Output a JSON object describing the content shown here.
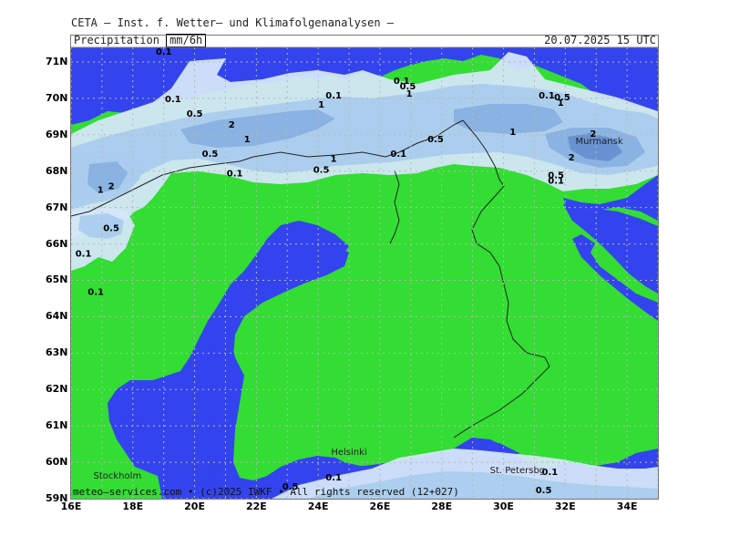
{
  "header": {
    "title": "CETA – Inst. f. Wetter– und Klimafolgenanalysen –",
    "subtitle_prefix": "Precipitation",
    "unit": "mm/6h",
    "datetime": "20.07.2025  15 UTC"
  },
  "footer": "meteo–services.com • (c)2025 IWKF • All rights reserved (12+027)",
  "axes": {
    "lat_labels": [
      "71N",
      "70N",
      "69N",
      "68N",
      "67N",
      "66N",
      "65N",
      "64N",
      "63N",
      "62N",
      "61N",
      "60N",
      "59N"
    ],
    "lon_labels": [
      "16E",
      "18E",
      "20E",
      "22E",
      "24E",
      "26E",
      "28E",
      "30E",
      "32E",
      "34E"
    ],
    "lat_range": [
      59,
      71.4
    ],
    "lon_range": [
      16,
      35
    ]
  },
  "colors": {
    "land": "#33dd33",
    "sea": "#3344ee",
    "precip_0_1": "#d4e6f8",
    "precip_0_5": "#aaccee",
    "precip_1": "#88b0e0",
    "precip_2": "#6690d0",
    "grid": "#b8b8b8",
    "border": "#222222"
  },
  "cities": [
    {
      "name": "Helsinki",
      "lon": 25.0,
      "lat": 60.2
    },
    {
      "name": "Stockholm",
      "lon": 17.5,
      "lat": 59.55
    },
    {
      "name": "St. Petersbg.",
      "lon": 30.5,
      "lat": 59.7
    },
    {
      "name": "Murmansk",
      "lon": 33.1,
      "lat": 68.75
    }
  ],
  "contour_labels": [
    {
      "text": "0.1",
      "lon": 19.0,
      "lat": 71.2
    },
    {
      "text": "0.1",
      "lon": 19.3,
      "lat": 69.9
    },
    {
      "text": "0.5",
      "lon": 20.0,
      "lat": 69.5
    },
    {
      "text": "2",
      "lon": 21.2,
      "lat": 69.2
    },
    {
      "text": "1",
      "lon": 21.7,
      "lat": 68.8
    },
    {
      "text": "0.5",
      "lon": 20.5,
      "lat": 68.4
    },
    {
      "text": "0.1",
      "lon": 21.3,
      "lat": 67.85
    },
    {
      "text": "0.1",
      "lon": 24.5,
      "lat": 70.0
    },
    {
      "text": "1",
      "lon": 24.1,
      "lat": 69.75
    },
    {
      "text": "1",
      "lon": 24.5,
      "lat": 68.25
    },
    {
      "text": "0.5",
      "lon": 24.1,
      "lat": 67.95
    },
    {
      "text": "0.1",
      "lon": 26.6,
      "lat": 68.4
    },
    {
      "text": "0.1",
      "lon": 26.7,
      "lat": 70.4
    },
    {
      "text": "0.5",
      "lon": 26.9,
      "lat": 70.25
    },
    {
      "text": "1",
      "lon": 26.95,
      "lat": 70.05
    },
    {
      "text": "0.5",
      "lon": 27.8,
      "lat": 68.8
    },
    {
      "text": "1",
      "lon": 30.3,
      "lat": 69.0
    },
    {
      "text": "0.1",
      "lon": 31.4,
      "lat": 70.0
    },
    {
      "text": "0.5",
      "lon": 31.9,
      "lat": 69.95
    },
    {
      "text": "1",
      "lon": 31.85,
      "lat": 69.8
    },
    {
      "text": "2",
      "lon": 32.9,
      "lat": 68.95
    },
    {
      "text": "2",
      "lon": 32.2,
      "lat": 68.3
    },
    {
      "text": "0.5",
      "lon": 31.7,
      "lat": 67.8
    },
    {
      "text": "0.1",
      "lon": 31.7,
      "lat": 67.65
    },
    {
      "text": "2",
      "lon": 17.3,
      "lat": 67.5
    },
    {
      "text": "1",
      "lon": 16.95,
      "lat": 67.4
    },
    {
      "text": "0.5",
      "lon": 17.3,
      "lat": 66.35
    },
    {
      "text": "0.1",
      "lon": 16.4,
      "lat": 65.65
    },
    {
      "text": "0.1",
      "lon": 16.8,
      "lat": 64.6
    },
    {
      "text": "0.1",
      "lon": 24.5,
      "lat": 59.5
    },
    {
      "text": "0.5",
      "lon": 23.1,
      "lat": 59.25
    },
    {
      "text": "0.1",
      "lon": 31.5,
      "lat": 59.65
    },
    {
      "text": "0.5",
      "lon": 31.3,
      "lat": 59.15
    }
  ]
}
